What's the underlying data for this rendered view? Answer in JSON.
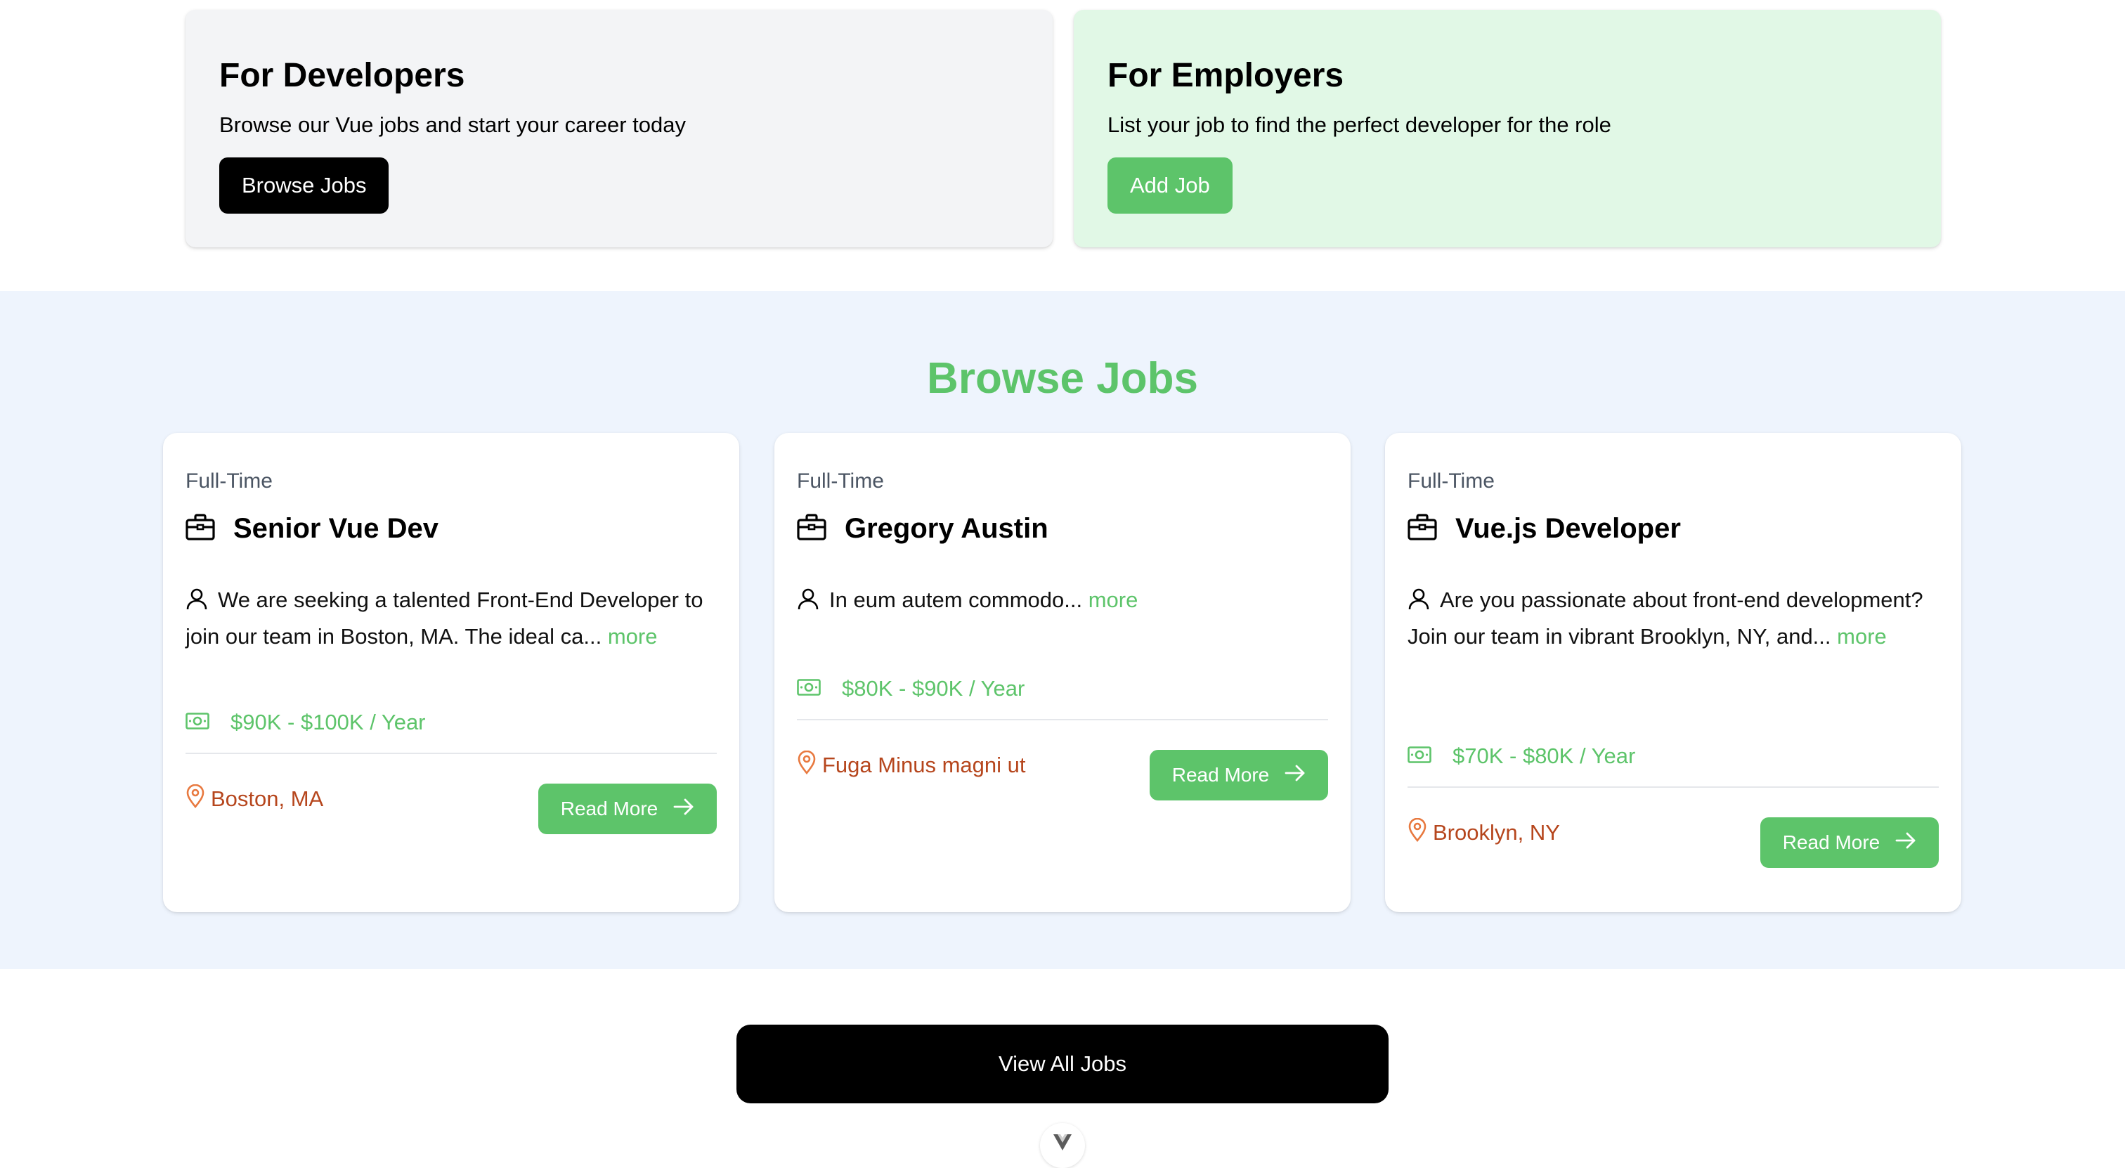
{
  "promo": {
    "developers": {
      "title": "For Developers",
      "text": "Browse our Vue jobs and start your career today",
      "button": "Browse Jobs"
    },
    "employers": {
      "title": "For Employers",
      "text": "List your job to find the perfect developer for the role",
      "button": "Add Job"
    }
  },
  "browse": {
    "title": "Browse Jobs",
    "jobs": [
      {
        "type": "Full-Time",
        "title": "Senior Vue Dev",
        "description": "We are seeking a talented Front-End Developer to join our team in Boston, MA. The ideal ca...",
        "more": "more",
        "salary": "$90K - $100K / Year",
        "location": "Boston, MA",
        "read_more": "Read More"
      },
      {
        "type": "Full-Time",
        "title": "Gregory Austin",
        "description": "In eum autem commodo...",
        "more": "more",
        "salary": "$80K - $90K / Year",
        "location": "Fuga Minus magni ut",
        "read_more": "Read More"
      },
      {
        "type": "Full-Time",
        "title": "Vue.js Developer",
        "description": "Are you passionate about front-end development? Join our team in vibrant Brooklyn, NY, and...",
        "more": "more",
        "salary": "$70K - $80K / Year",
        "location": "Brooklyn, NY",
        "read_more": "Read More"
      }
    ]
  },
  "view_all": "View All Jobs",
  "icons": {
    "job_type": "briefcase-icon",
    "description": "person-icon",
    "salary": "money-icon",
    "location": "map-pin-icon",
    "read_more": "arrow-right-icon",
    "scroll": "vue-logo-icon"
  },
  "colors": {
    "accent_green": "#5dc46a",
    "location_orange": "#b6461d",
    "browse_bg": "#eef4fd",
    "employer_card_bg": "#e1f8e6",
    "developer_card_bg": "#f3f4f6"
  }
}
